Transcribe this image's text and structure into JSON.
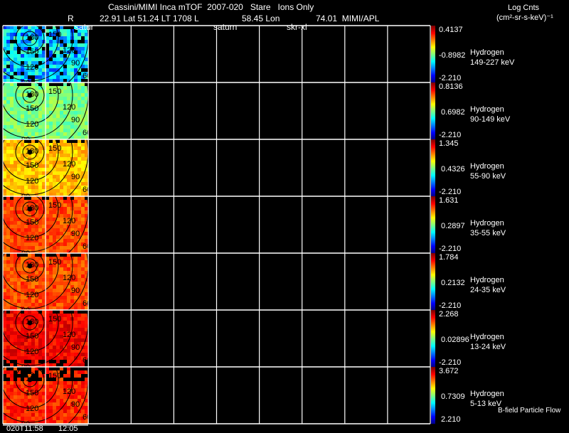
{
  "header": {
    "title": "Cassini/MIMI Inca mTOF  2007-020   Stare   Ions Only",
    "r_label": "R",
    "position_info": "22.91 Lat 51.24 LT 1708 L",
    "lon_info": "58.45 Lon",
    "lon_value_info": "74.01  MIMI/APL",
    "overlay_labels": [
      "satur",
      "saturn",
      "skr-xl"
    ],
    "units_title": "Log Cnts",
    "units": "(cm²-sr-s-keV)⁻¹"
  },
  "chart_data": {
    "type": "heatmap",
    "colormap": "rainbow (blue-cyan-green-yellow-red)",
    "grid": true,
    "x_tick_labels": [
      "020T11:58",
      "12:05"
    ],
    "contour_labels": [
      "180",
      "150",
      "120",
      "90",
      "60"
    ],
    "panels": [
      {
        "species": "Hydrogen",
        "energy": "149-227 keV",
        "cbar_max": "0.4137",
        "cbar_mid": "-0.8982",
        "cbar_min": "-2.210",
        "dominant_color": "#1e8cff"
      },
      {
        "species": "Hydrogen",
        "energy": "90-149 keV",
        "cbar_max": "0.8136",
        "cbar_mid": "0.6982",
        "cbar_min": "-2.210",
        "dominant_color": "#7fe89a"
      },
      {
        "species": "Hydrogen",
        "energy": "55-90 keV",
        "cbar_max": "1.345",
        "cbar_mid": "0.4326",
        "cbar_min": "-2.210",
        "dominant_color": "#f0d020"
      },
      {
        "species": "Hydrogen",
        "energy": "35-55 keV",
        "cbar_max": "1.631",
        "cbar_mid": "0.2897",
        "cbar_min": "-2.210",
        "dominant_color": "#f59a20"
      },
      {
        "species": "Hydrogen",
        "energy": "24-35 keV",
        "cbar_max": "1.784",
        "cbar_mid": "0.2132",
        "cbar_min": "-2.210",
        "dominant_color": "#f58a18"
      },
      {
        "species": "Hydrogen",
        "energy": "13-24 keV",
        "cbar_max": "2.268",
        "cbar_mid": "0.02896",
        "cbar_min": "-2.210",
        "dominant_color": "#ee4a10"
      },
      {
        "species": "Hydrogen",
        "energy": "5-13 keV",
        "cbar_max": "3.672",
        "cbar_mid": "0.7309",
        "cbar_min": "2.210",
        "dominant_color": "#f07018"
      }
    ],
    "footer_note": "B-field Particle Flow"
  }
}
